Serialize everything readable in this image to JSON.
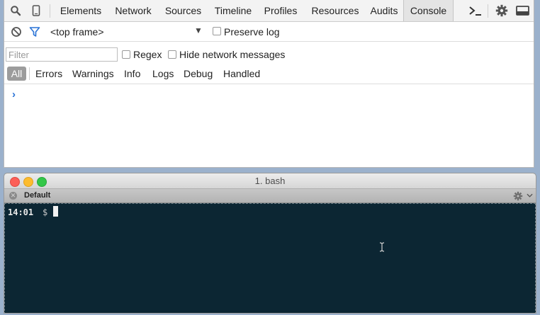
{
  "devtools": {
    "tabs": [
      "Elements",
      "Network",
      "Sources",
      "Timeline",
      "Profiles",
      "Resources",
      "Audits",
      "Console"
    ],
    "active_tab": "Console",
    "frame_select": "<top frame>",
    "preserve_log_label": "Preserve log",
    "filter_placeholder": "Filter",
    "regex_label": "Regex",
    "hide_network_label": "Hide network messages",
    "levels": {
      "all": "All",
      "errors": "Errors",
      "warnings": "Warnings",
      "info": "Info",
      "logs": "Logs",
      "debug": "Debug",
      "handled": "Handled"
    },
    "prompt_glyph": "›",
    "icons": [
      "search-icon",
      "device-mode-icon",
      "drawer-toggle-icon",
      "settings-icon",
      "dock-side-icon",
      "clear-console-icon",
      "filter-icon"
    ],
    "colors": {
      "accent": "#2a73d6",
      "active_tab_bg": "#e4e4e4"
    }
  },
  "terminal": {
    "title": "1. bash",
    "tab_label": "Default",
    "prompt_time": "14:01",
    "prompt_symbol": "$",
    "colors": {
      "background": "#0c2633",
      "text": "#e8e8e8"
    }
  }
}
